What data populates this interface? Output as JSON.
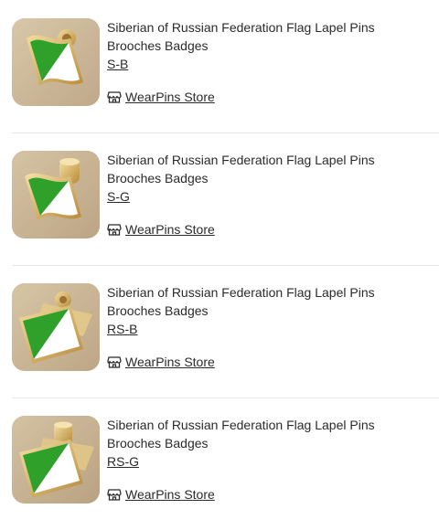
{
  "products": [
    {
      "title": "Siberian of Russian Federation Flag Lapel Pins Brooches Badges",
      "variant": "S-B",
      "store": "WearPins Store",
      "image_icon": "waving-flag-pin-icon"
    },
    {
      "title": "Siberian of Russian Federation Flag Lapel Pins Brooches Badges",
      "variant": "S-G",
      "store": "WearPins Store",
      "image_icon": "waving-flag-pin-icon"
    },
    {
      "title": "Siberian of Russian Federation Flag Lapel Pins Brooches Badges",
      "variant": "RS-B",
      "store": "WearPins Store",
      "image_icon": "rectangle-flag-pin-icon"
    },
    {
      "title": "Siberian of Russian Federation Flag Lapel Pins Brooches Badges",
      "variant": "RS-G",
      "store": "WearPins Store",
      "image_icon": "rectangle-flag-pin-icon"
    }
  ],
  "colors": {
    "flag_green": "#2fa12a",
    "flag_white": "#ffffff",
    "gold": "#d9b46a",
    "thumb_bg": "#cdb99a"
  }
}
